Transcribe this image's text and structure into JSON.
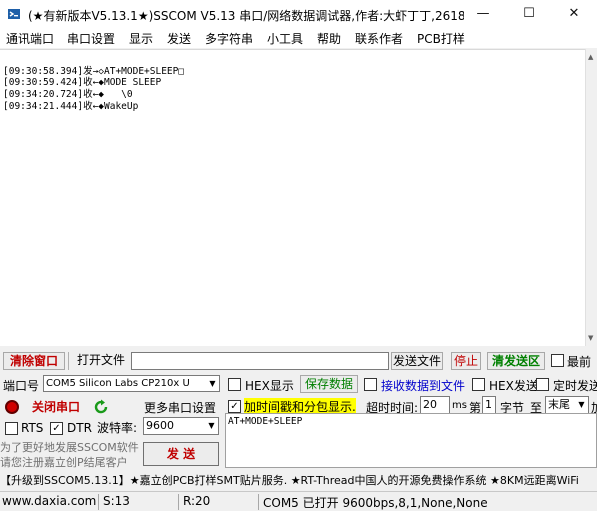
{
  "window": {
    "title": "(★有新版本V5.13.1★)SSCOM V5.13 串口/网络数据调试器,作者:大虾丁丁,2618...",
    "minimize": "—",
    "maximize": "☐",
    "close": "✕"
  },
  "menu": [
    "通讯端口",
    "串口设置",
    "显示",
    "发送",
    "多字符串",
    "小工具",
    "帮助",
    "联系作者",
    "PCB打样"
  ],
  "receive_log": [
    "[09:30:58.394]发→◇AT+MODE+SLEEP□",
    "[09:30:59.424]收←◆MODE SLEEP",
    "[09:34:20.724]收←◆   \\0",
    "[09:34:21.444]收←◆WakeUp"
  ],
  "toolbar": {
    "clear_window": "清除窗口",
    "open_file": "打开文件",
    "send_file": "发送文件",
    "stop": "停止",
    "clear_send_area": "清发送区",
    "last": "最前"
  },
  "port": {
    "label": "端口号",
    "value": "COM5 Silicon Labs CP210x U",
    "hex_display": "HEX显示",
    "save_data": "保存数据",
    "recv_to_file": "接收数据到文件",
    "hex_send": "HEX发送",
    "timed_send": "定时发送"
  },
  "controls": {
    "close_port": "关闭串口",
    "more_settings": "更多串口设置",
    "timestamp": "加时间戳和分包显示.",
    "timeout_label": "超时时间:",
    "timeout_value": "20",
    "timeout_unit": "ms",
    "page_label": "第",
    "page_value": "1",
    "byte_label": "字节",
    "to_label": "至",
    "tail_value": "末尾",
    "add_label": "加",
    "rts": "RTS",
    "dtr": "DTR",
    "baud_label": "波特率:",
    "baud_value": "9600",
    "send": "发 送"
  },
  "send_text": "AT+MODE+SLEEP",
  "notice": {
    "line1": "为了更好地发展SSCOM软件",
    "line2": "请您注册嘉立创P结尾客户"
  },
  "promo": "【升级到SSCOM5.13.1】★嘉立创PCB打样SMT贴片服务. ★RT-Thread中国人的开源免费操作系统 ★8KM远距离WiFi",
  "status": {
    "website": "www.daxia.com",
    "sent": "S:13",
    "received": "R:20",
    "port_state": "COM5 已打开  9600bps,8,1,None,None"
  },
  "colors": {
    "red_text": "#c00000",
    "green_text": "#008000",
    "highlight_yellow": "#ffff00",
    "link_blue": "#0000cc"
  }
}
